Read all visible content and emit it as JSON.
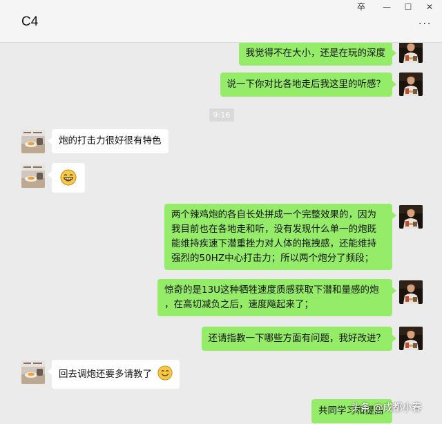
{
  "window": {
    "title": "C4",
    "pin_glyph": "卒",
    "minimize_glyph": "—",
    "maximize_glyph": "☐",
    "close_glyph": "✕",
    "more_glyph": "···"
  },
  "chat": {
    "timestamp": "9:16",
    "messages": [
      {
        "side": "right",
        "text": "我觉得不在大小，还是在玩的深度"
      },
      {
        "side": "right",
        "text": "说一下你对比各地走后我这里的听感？"
      },
      {
        "side": "left",
        "text": "炮的打击力很好很有特色"
      },
      {
        "side": "left",
        "emoji": "grinning-face"
      },
      {
        "side": "right",
        "lines": [
          "两个辣鸡炮的各自长处拼成一个完整效果的，因为",
          "我目前也在各地走和听，没有发现什么单一的炮既",
          "能维持疾速下潜重挫力对人体的拖拽感，还能维持",
          "强烈的50HZ中心打击力；所以两个炮分了频段；"
        ]
      },
      {
        "side": "right",
        "lines": [
          "惊奇的是13U这种牺牲速度质感获取下潜和量感的炮",
          "，在高切减负之后，速度飚起来了；"
        ]
      },
      {
        "side": "right",
        "text": "还请指教一下哪些方面有问题，我好改进？"
      },
      {
        "side": "left",
        "text": "回去调炮还要多请教了",
        "emoji": "smiling-face"
      },
      {
        "side": "right",
        "text": "共同学习和提高"
      }
    ]
  },
  "watermark": "头条 @成都小春",
  "colors": {
    "bubble_right": "#95ec69",
    "bubble_left": "#ffffff",
    "background": "#ebebeb"
  }
}
